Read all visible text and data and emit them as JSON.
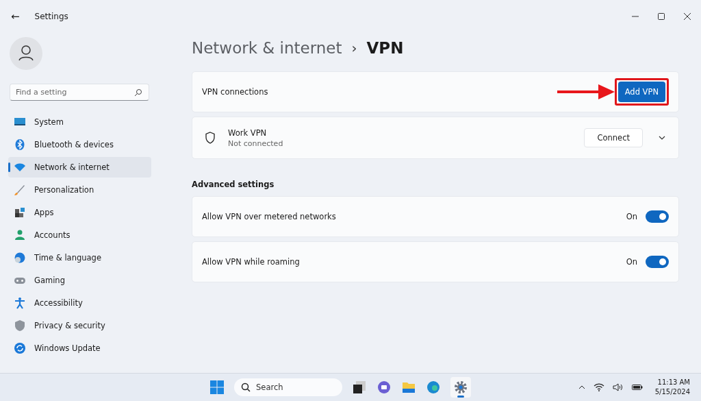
{
  "window": {
    "title": "Settings",
    "back": "←"
  },
  "search": {
    "placeholder": "Find a setting"
  },
  "sidebar": {
    "items": [
      {
        "label": "System",
        "selected": false
      },
      {
        "label": "Bluetooth & devices",
        "selected": false
      },
      {
        "label": "Network & internet",
        "selected": true
      },
      {
        "label": "Personalization",
        "selected": false
      },
      {
        "label": "Apps",
        "selected": false
      },
      {
        "label": "Accounts",
        "selected": false
      },
      {
        "label": "Time & language",
        "selected": false
      },
      {
        "label": "Gaming",
        "selected": false
      },
      {
        "label": "Accessibility",
        "selected": false
      },
      {
        "label": "Privacy & security",
        "selected": false
      },
      {
        "label": "Windows Update",
        "selected": false
      }
    ]
  },
  "breadcrumb": {
    "parent": "Network & internet",
    "separator": "›",
    "current": "VPN"
  },
  "vpn_connections": {
    "label": "VPN connections",
    "button": "Add VPN"
  },
  "connections": [
    {
      "name": "Work VPN",
      "status": "Not connected",
      "button": "Connect",
      "expanded": false
    }
  ],
  "advanced": {
    "heading": "Advanced settings",
    "settings": [
      {
        "label": "Allow VPN over metered networks",
        "state": "On",
        "on": true
      },
      {
        "label": "Allow VPN while roaming",
        "state": "On",
        "on": true
      }
    ]
  },
  "taskbar": {
    "search": "Search",
    "time": "11:13 AM",
    "date": "5/15/2024"
  }
}
